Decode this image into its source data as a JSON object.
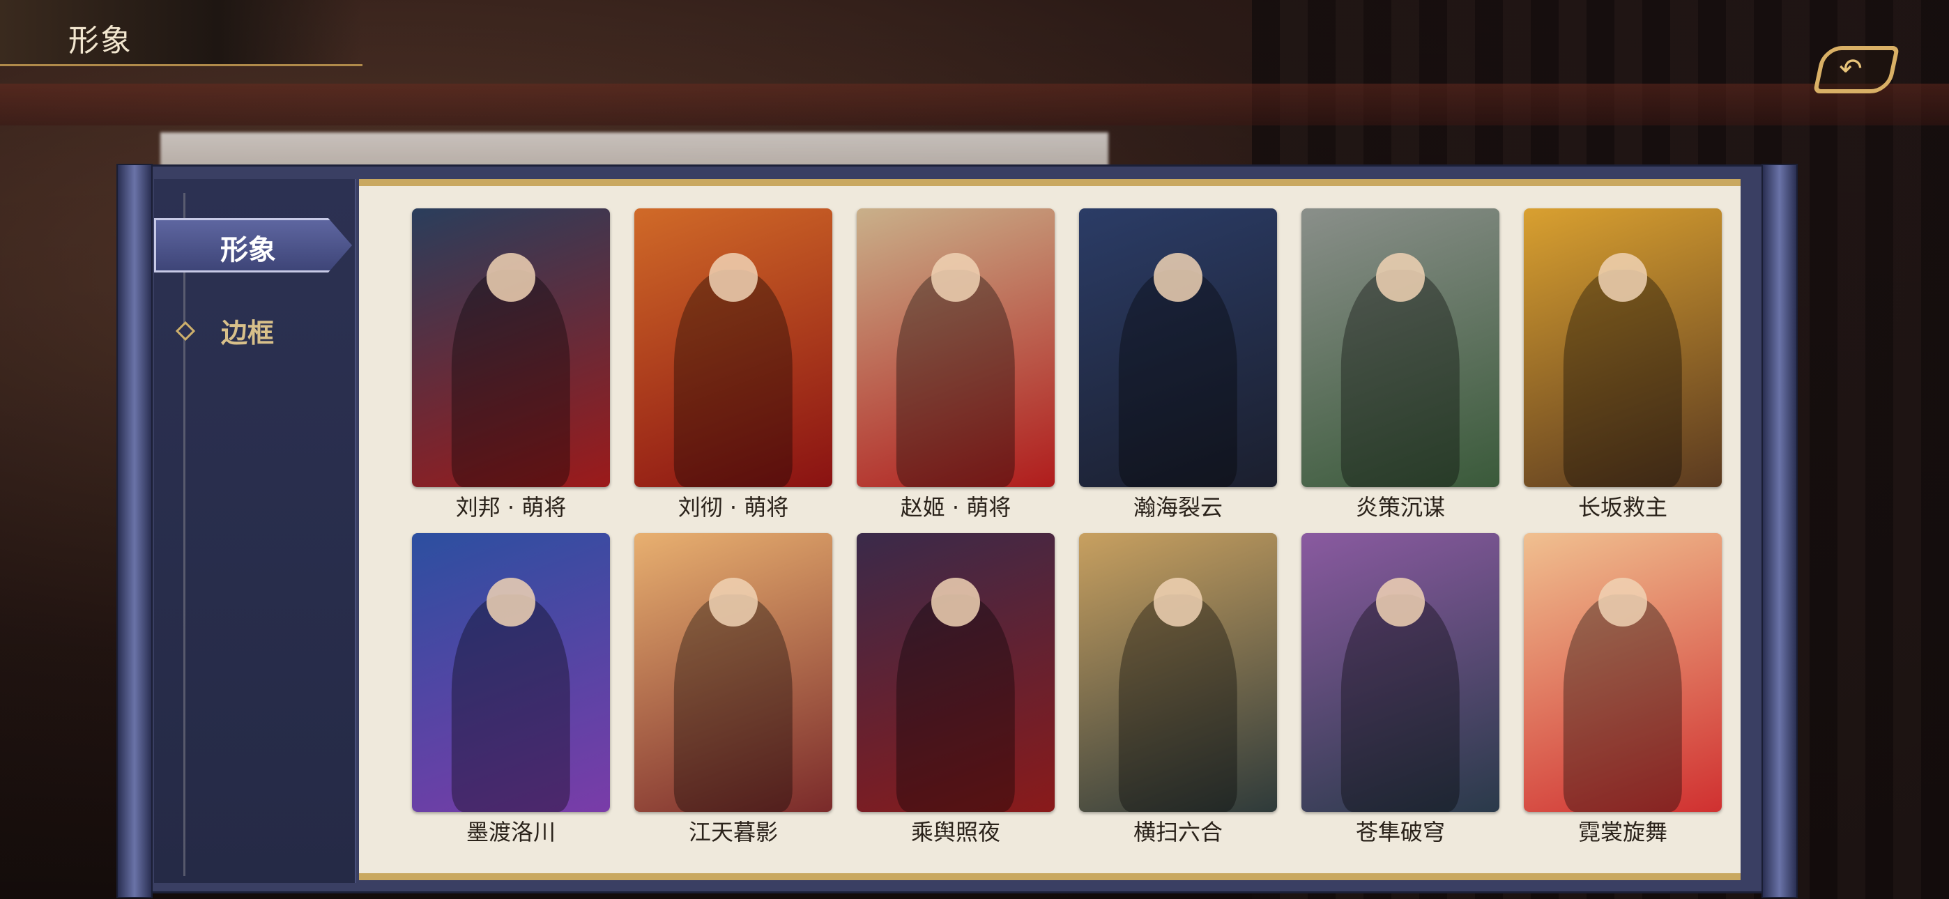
{
  "header": {
    "title": "形象"
  },
  "back_button": {
    "icon": "back-arrow-icon"
  },
  "sidebar": {
    "items": [
      {
        "label": "形象",
        "active": true
      },
      {
        "label": "边框",
        "active": false
      }
    ]
  },
  "skins": [
    {
      "name": "刘邦 · 萌将",
      "palette": [
        "#2a3e5c",
        "#9c1a1a"
      ]
    },
    {
      "name": "刘彻 · 萌将",
      "palette": [
        "#d06a28",
        "#8a1212"
      ]
    },
    {
      "name": "赵姬 · 萌将",
      "palette": [
        "#c9b08a",
        "#b01c1c"
      ]
    },
    {
      "name": "瀚海裂云",
      "palette": [
        "#2b3c66",
        "#1b1f2e"
      ]
    },
    {
      "name": "炎策沉谋",
      "palette": [
        "#8a8f8a",
        "#3a5a3a"
      ]
    },
    {
      "name": "长坂救主",
      "palette": [
        "#d9a030",
        "#5a3a20"
      ]
    },
    {
      "name": "墨渡洛川",
      "palette": [
        "#2c4fa0",
        "#7a3ca8"
      ]
    },
    {
      "name": "江天暮影",
      "palette": [
        "#e8b070",
        "#7a2a2a"
      ]
    },
    {
      "name": "乘舆照夜",
      "palette": [
        "#3a2a4a",
        "#8a1a1a"
      ]
    },
    {
      "name": "横扫六合",
      "palette": [
        "#c8a060",
        "#2e3a3a"
      ]
    },
    {
      "name": "苍隼破穹",
      "palette": [
        "#8a5aa0",
        "#2a3a4a"
      ]
    },
    {
      "name": "霓裳旋舞",
      "palette": [
        "#f0c090",
        "#d03030"
      ]
    }
  ]
}
